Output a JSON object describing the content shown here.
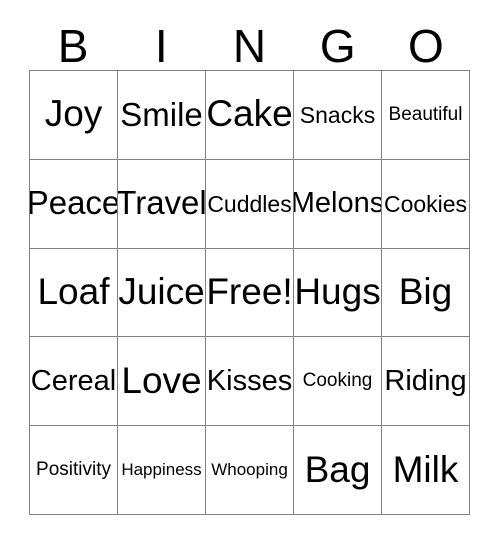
{
  "card": {
    "title": "BINGO",
    "border_color": "#828282",
    "background_color": "#ffffff",
    "text_color": "#000000"
  },
  "header": {
    "letters": [
      "B",
      "I",
      "N",
      "G",
      "O"
    ]
  },
  "grid": {
    "columns": 5,
    "rows": 5,
    "free_space": "Free!",
    "cells": [
      [
        {
          "label": "Joy",
          "size": "size-xl"
        },
        {
          "label": "Smile",
          "size": "size-lg"
        },
        {
          "label": "Cake",
          "size": "size-xl"
        },
        {
          "label": "Snacks",
          "size": "size-sm"
        },
        {
          "label": "Beautiful",
          "size": "size-xs"
        }
      ],
      [
        {
          "label": "Peace",
          "size": "size-lg"
        },
        {
          "label": "Travel",
          "size": "size-lg"
        },
        {
          "label": "Cuddles",
          "size": "size-sm"
        },
        {
          "label": "Melons",
          "size": "size-md"
        },
        {
          "label": "Cookies",
          "size": "size-sm"
        }
      ],
      [
        {
          "label": "Loaf",
          "size": "size-xl"
        },
        {
          "label": "Juice",
          "size": "size-xl"
        },
        {
          "label": "Free!",
          "size": "size-xl"
        },
        {
          "label": "Hugs",
          "size": "size-xl"
        },
        {
          "label": "Big",
          "size": "size-xl"
        }
      ],
      [
        {
          "label": "Cereal",
          "size": "size-md"
        },
        {
          "label": "Love",
          "size": "size-xl"
        },
        {
          "label": "Kisses",
          "size": "size-md"
        },
        {
          "label": "Cooking",
          "size": "size-xs"
        },
        {
          "label": "Riding",
          "size": "size-md"
        }
      ],
      [
        {
          "label": "Positivity",
          "size": "size-xs"
        },
        {
          "label": "Happiness",
          "size": "size-xxs"
        },
        {
          "label": "Whooping",
          "size": "size-xxs"
        },
        {
          "label": "Bag",
          "size": "size-xl"
        },
        {
          "label": "Milk",
          "size": "size-xl"
        }
      ]
    ]
  }
}
